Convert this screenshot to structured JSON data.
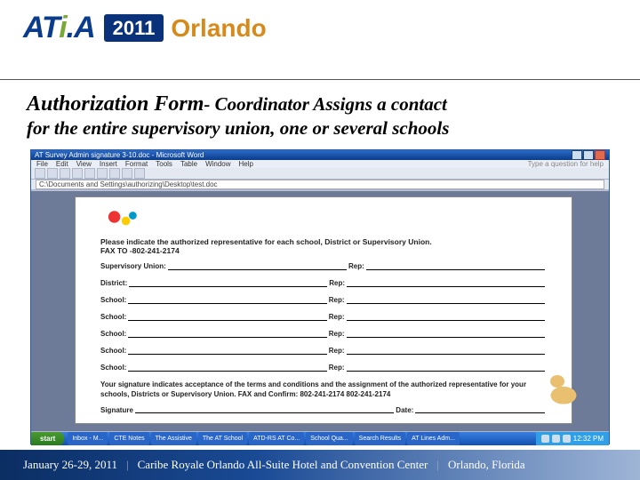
{
  "header": {
    "brand": "ATi.A",
    "year": "2011",
    "city": "Orlando"
  },
  "heading": {
    "line1_strong": "Authorization Form",
    "line1_rest": "- Coordinator Assigns a contact",
    "line2": "for the entire supervisory union, one or several schools"
  },
  "word": {
    "title": "AT Survey Admin signature 3-10.doc - Microsoft Word",
    "menu": [
      "File",
      "Edit",
      "View",
      "Insert",
      "Format",
      "Tools",
      "Table",
      "Window",
      "Help"
    ],
    "help_placeholder": "Type a question for help",
    "url": "C:\\Documents and Settings\\authorizing\\Desktop\\test.doc",
    "instr": "Please indicate the authorized representative for each school, District or Supervisory Union.",
    "fax": "FAX TO -802-241-2174",
    "rows": [
      {
        "label": "Supervisory Union:",
        "rep": "Rep:"
      },
      {
        "label": "District:",
        "rep": "Rep:"
      },
      {
        "label": "School:",
        "rep": "Rep:"
      },
      {
        "label": "School:",
        "rep": "Rep:"
      },
      {
        "label": "School:",
        "rep": "Rep:"
      },
      {
        "label": "School:",
        "rep": "Rep:"
      },
      {
        "label": "School:",
        "rep": "Rep:"
      }
    ],
    "disclaimer": "Your signature indicates acceptance of the terms and conditions and the assignment of the authorized representative for your schools, Districts or Supervisory Union. FAX and Confirm: 802-241-2174  802-241-2174",
    "sig": "Signature",
    "date": "Date:"
  },
  "taskbar": {
    "start": "start",
    "items": [
      "Inbox - M...",
      "CTE Notes",
      "The Assistive",
      "The AT School",
      "ATD-RS AT Co...",
      "School Qua...",
      "Search Results",
      "AT Lines Adm..."
    ],
    "time": "12:32 PM"
  },
  "footer": {
    "dates": "January 26-29, 2011",
    "venue": "Caribe Royale Orlando All-Suite Hotel and Convention Center",
    "city": "Orlando, Florida"
  }
}
